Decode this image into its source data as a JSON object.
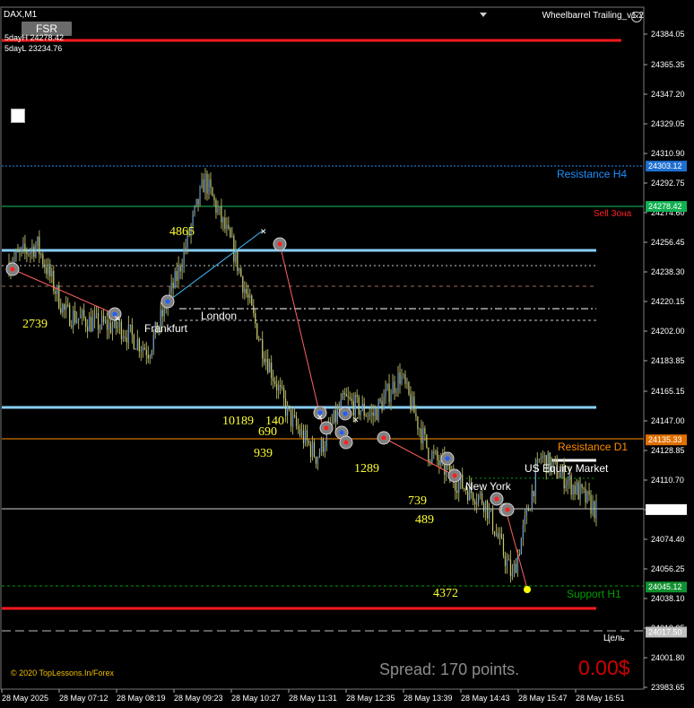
{
  "header": {
    "symbol": "DAX,M1",
    "indicator": "Wheelbarrel Trailing_v1.2",
    "fsr_button": "FSR",
    "five_day_high": "5dayH 24278.42",
    "five_day_low": "5dayL 23234.76"
  },
  "footer": {
    "copyright": "© 2020 TopLessons.In/Forex",
    "spread": "Spread: 170 points.",
    "profit": "0.00$"
  },
  "price_axis": {
    "ticks": [
      "24384.05",
      "24365.35",
      "24347.20",
      "24329.05",
      "24310.90",
      "24292.75",
      "24274.60",
      "24256.45",
      "24238.30",
      "24220.15",
      "24202.00",
      "24183.85",
      "24165.15",
      "24147.00",
      "24128.85",
      "24110.70",
      "24092.62",
      "24074.40",
      "24056.25",
      "24038.10",
      "24019.95",
      "24001.80",
      "23983.65"
    ],
    "tags": [
      {
        "text": "24303.12",
        "color": "#1e90ff",
        "bg": "#1e6fd0"
      },
      {
        "text": "24278.42",
        "color": "#00c060",
        "bg": "#10b050"
      },
      {
        "text": "24135.33",
        "color": "#ff8c00",
        "bg": "#e07000"
      },
      {
        "text": "24092.62",
        "color": "#ffffff",
        "bg": "#ffffff"
      },
      {
        "text": "24045.12",
        "color": "#00a000",
        "bg": "#109030"
      },
      {
        "text": "24017.50",
        "color": "#b0b0b0",
        "bg": "#c0c0c0"
      }
    ]
  },
  "time_axis": [
    "28 May 2025",
    "28 May 07:12",
    "28 May 08:19",
    "28 May 09:23",
    "28 May 10:27",
    "28 May 11:31",
    "28 May 12:35",
    "28 May 13:39",
    "28 May 14:43",
    "28 May 15:47",
    "28 May 16:51"
  ],
  "levels": {
    "resistance_h4": "Resistance H4",
    "sell_zone": "Sell Зона",
    "resistance_d1": "Resistance D1",
    "support_h1": "Support H1",
    "target": "Цель"
  },
  "sessions": {
    "frankfurt": "Frankfurt",
    "london": "London",
    "new_york": "New York",
    "us_equity": "US Equity Market"
  },
  "annotations": [
    "4865",
    "2739",
    "10189",
    "140",
    "690",
    "939",
    "1289",
    "739",
    "489",
    "4372"
  ],
  "chart_data": {
    "type": "candlestick",
    "symbol": "DAX",
    "timeframe": "M1",
    "x": [
      "28 May 2025",
      "28 May 07:12",
      "28 May 08:19",
      "28 May 09:23",
      "28 May 10:27",
      "28 May 11:31",
      "28 May 12:35",
      "28 May 13:39",
      "28 May 14:43",
      "28 May 15:47",
      "28 May 16:51"
    ],
    "ylim": [
      23983.65,
      24384.05
    ],
    "price_path": [
      {
        "t": "28 May 2025",
        "price": 24244
      },
      {
        "t": "06:30",
        "price": 24255
      },
      {
        "t": "07:12",
        "price": 24213
      },
      {
        "t": "07:45",
        "price": 24207
      },
      {
        "t": "08:19",
        "price": 24204
      },
      {
        "t": "08:50",
        "price": 24190
      },
      {
        "t": "09:23",
        "price": 24235
      },
      {
        "t": "10:10",
        "price": 24295
      },
      {
        "t": "10:27",
        "price": 24253
      },
      {
        "t": "11:00",
        "price": 24195
      },
      {
        "t": "11:20",
        "price": 24150
      },
      {
        "t": "11:31",
        "price": 24125
      },
      {
        "t": "12:00",
        "price": 24160
      },
      {
        "t": "12:35",
        "price": 24150
      },
      {
        "t": "13:00",
        "price": 24175
      },
      {
        "t": "13:39",
        "price": 24128
      },
      {
        "t": "14:10",
        "price": 24110
      },
      {
        "t": "14:43",
        "price": 24098
      },
      {
        "t": "15:20",
        "price": 24051
      },
      {
        "t": "15:47",
        "price": 24125
      },
      {
        "t": "16:20",
        "price": 24110
      },
      {
        "t": "16:51",
        "price": 24092
      }
    ],
    "current_price": 24092.62,
    "horizontal_levels": [
      {
        "name": "red-top",
        "price": 24379
      },
      {
        "name": "Resistance H4",
        "price": 24303.12
      },
      {
        "name": "Sell Зона",
        "price": 24278.42
      },
      {
        "name": "blue-upper",
        "price": 24256
      },
      {
        "name": "Resistance D1",
        "price": 24135.33
      },
      {
        "name": "blue-lower",
        "price": 24150
      },
      {
        "name": "Support H1",
        "price": 24045.12
      },
      {
        "name": "red-bottom",
        "price": 24031
      },
      {
        "name": "Цель",
        "price": 24017.5
      }
    ]
  },
  "colors": {
    "background": "#000000",
    "candle": "#b8b86a",
    "red_line": "#ff1a1a",
    "light_blue": "#87cefa",
    "resistance_h4": "#1e90ff",
    "sell_zone": "#ff2020",
    "resistance_d1": "#ff8c00",
    "support_h1": "#00a000",
    "annotation": "#ffff33"
  }
}
